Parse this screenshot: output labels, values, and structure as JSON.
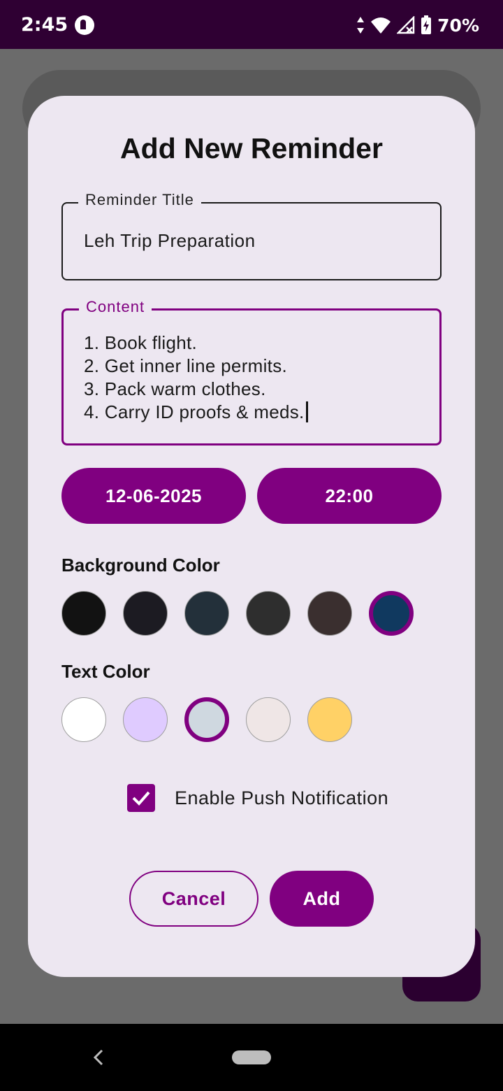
{
  "status_bar": {
    "time": "2:45",
    "battery": "70%",
    "icons": [
      "app-notification-icon",
      "data-arrows-icon",
      "wifi-icon",
      "signal-no-service-icon",
      "battery-charging-icon"
    ]
  },
  "dialog": {
    "title": "Add New Reminder",
    "title_field": {
      "label": "Reminder Title",
      "value": "Leh Trip Preparation"
    },
    "content_field": {
      "label": "Content",
      "lines": [
        "1. Book flight.",
        "2. Get inner line permits.",
        "3. Pack warm clothes.",
        "4. Carry ID proofs & meds."
      ]
    },
    "date": "12-06-2025",
    "time": "22:00",
    "background_color": {
      "label": "Background Color",
      "swatches": [
        "#121212",
        "#1c1b22",
        "#23303a",
        "#2e2e2e",
        "#3a2f2f",
        "#10395f"
      ],
      "selected_index": 5
    },
    "text_color": {
      "label": "Text Color",
      "swatches": [
        "#ffffff",
        "#dfcbff",
        "#cfd8e0",
        "#efe6e6",
        "#ffd166"
      ],
      "selected_index": 2
    },
    "push_notification": {
      "label": "Enable Push Notification",
      "checked": true
    },
    "cancel_label": "Cancel",
    "add_label": "Add"
  },
  "colors": {
    "accent": "#800080",
    "status_bar": "#2f0033",
    "dialog_bg": "#ede7f1",
    "scrim": "#6b6b6b"
  }
}
